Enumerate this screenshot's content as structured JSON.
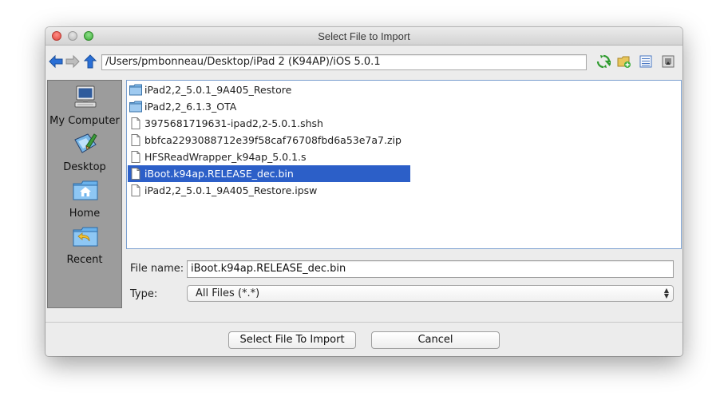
{
  "window": {
    "title": "Select File to Import"
  },
  "toolbar": {
    "path": "/Users/pmbonneau/Desktop/iPad 2 (K94AP)/iOS 5.0.1",
    "icons": [
      "back-arrow-icon",
      "forward-arrow-icon",
      "up-arrow-icon",
      "refresh-icon",
      "new-folder-icon",
      "list-view-icon",
      "details-view-icon"
    ]
  },
  "sidebar": {
    "items": [
      {
        "label": "My Computer",
        "icon": "computer-icon"
      },
      {
        "label": "Desktop",
        "icon": "desktop-icon"
      },
      {
        "label": "Home",
        "icon": "home-folder-icon"
      },
      {
        "label": "Recent",
        "icon": "recent-folder-icon"
      }
    ]
  },
  "files": [
    {
      "name": "iPad2,2_5.0.1_9A405_Restore",
      "kind": "folder"
    },
    {
      "name": "iPad2,2_6.1.3_OTA",
      "kind": "folder"
    },
    {
      "name": "3975681719631-ipad2,2-5.0.1.shsh",
      "kind": "file"
    },
    {
      "name": "bbfca2293088712e39f58caf76708fbd6a53e7a7.zip",
      "kind": "file"
    },
    {
      "name": "HFSReadWrapper_k94ap_5.0.1.s",
      "kind": "file"
    },
    {
      "name": "iBoot.k94ap.RELEASE_dec.bin",
      "kind": "file",
      "selected": true
    },
    {
      "name": "iPad2,2_5.0.1_9A405_Restore.ipsw",
      "kind": "file"
    }
  ],
  "form": {
    "filename_label": "File name:",
    "filename_value": "iBoot.k94ap.RELEASE_dec.bin",
    "type_label": "Type:",
    "type_value": "All Files (*.*)"
  },
  "buttons": {
    "import": "Select File To Import",
    "cancel": "Cancel"
  },
  "colors": {
    "selection": "#2c5fc8",
    "list_border": "#7a9fcf",
    "sidebar_bg": "#9c9c9c"
  }
}
